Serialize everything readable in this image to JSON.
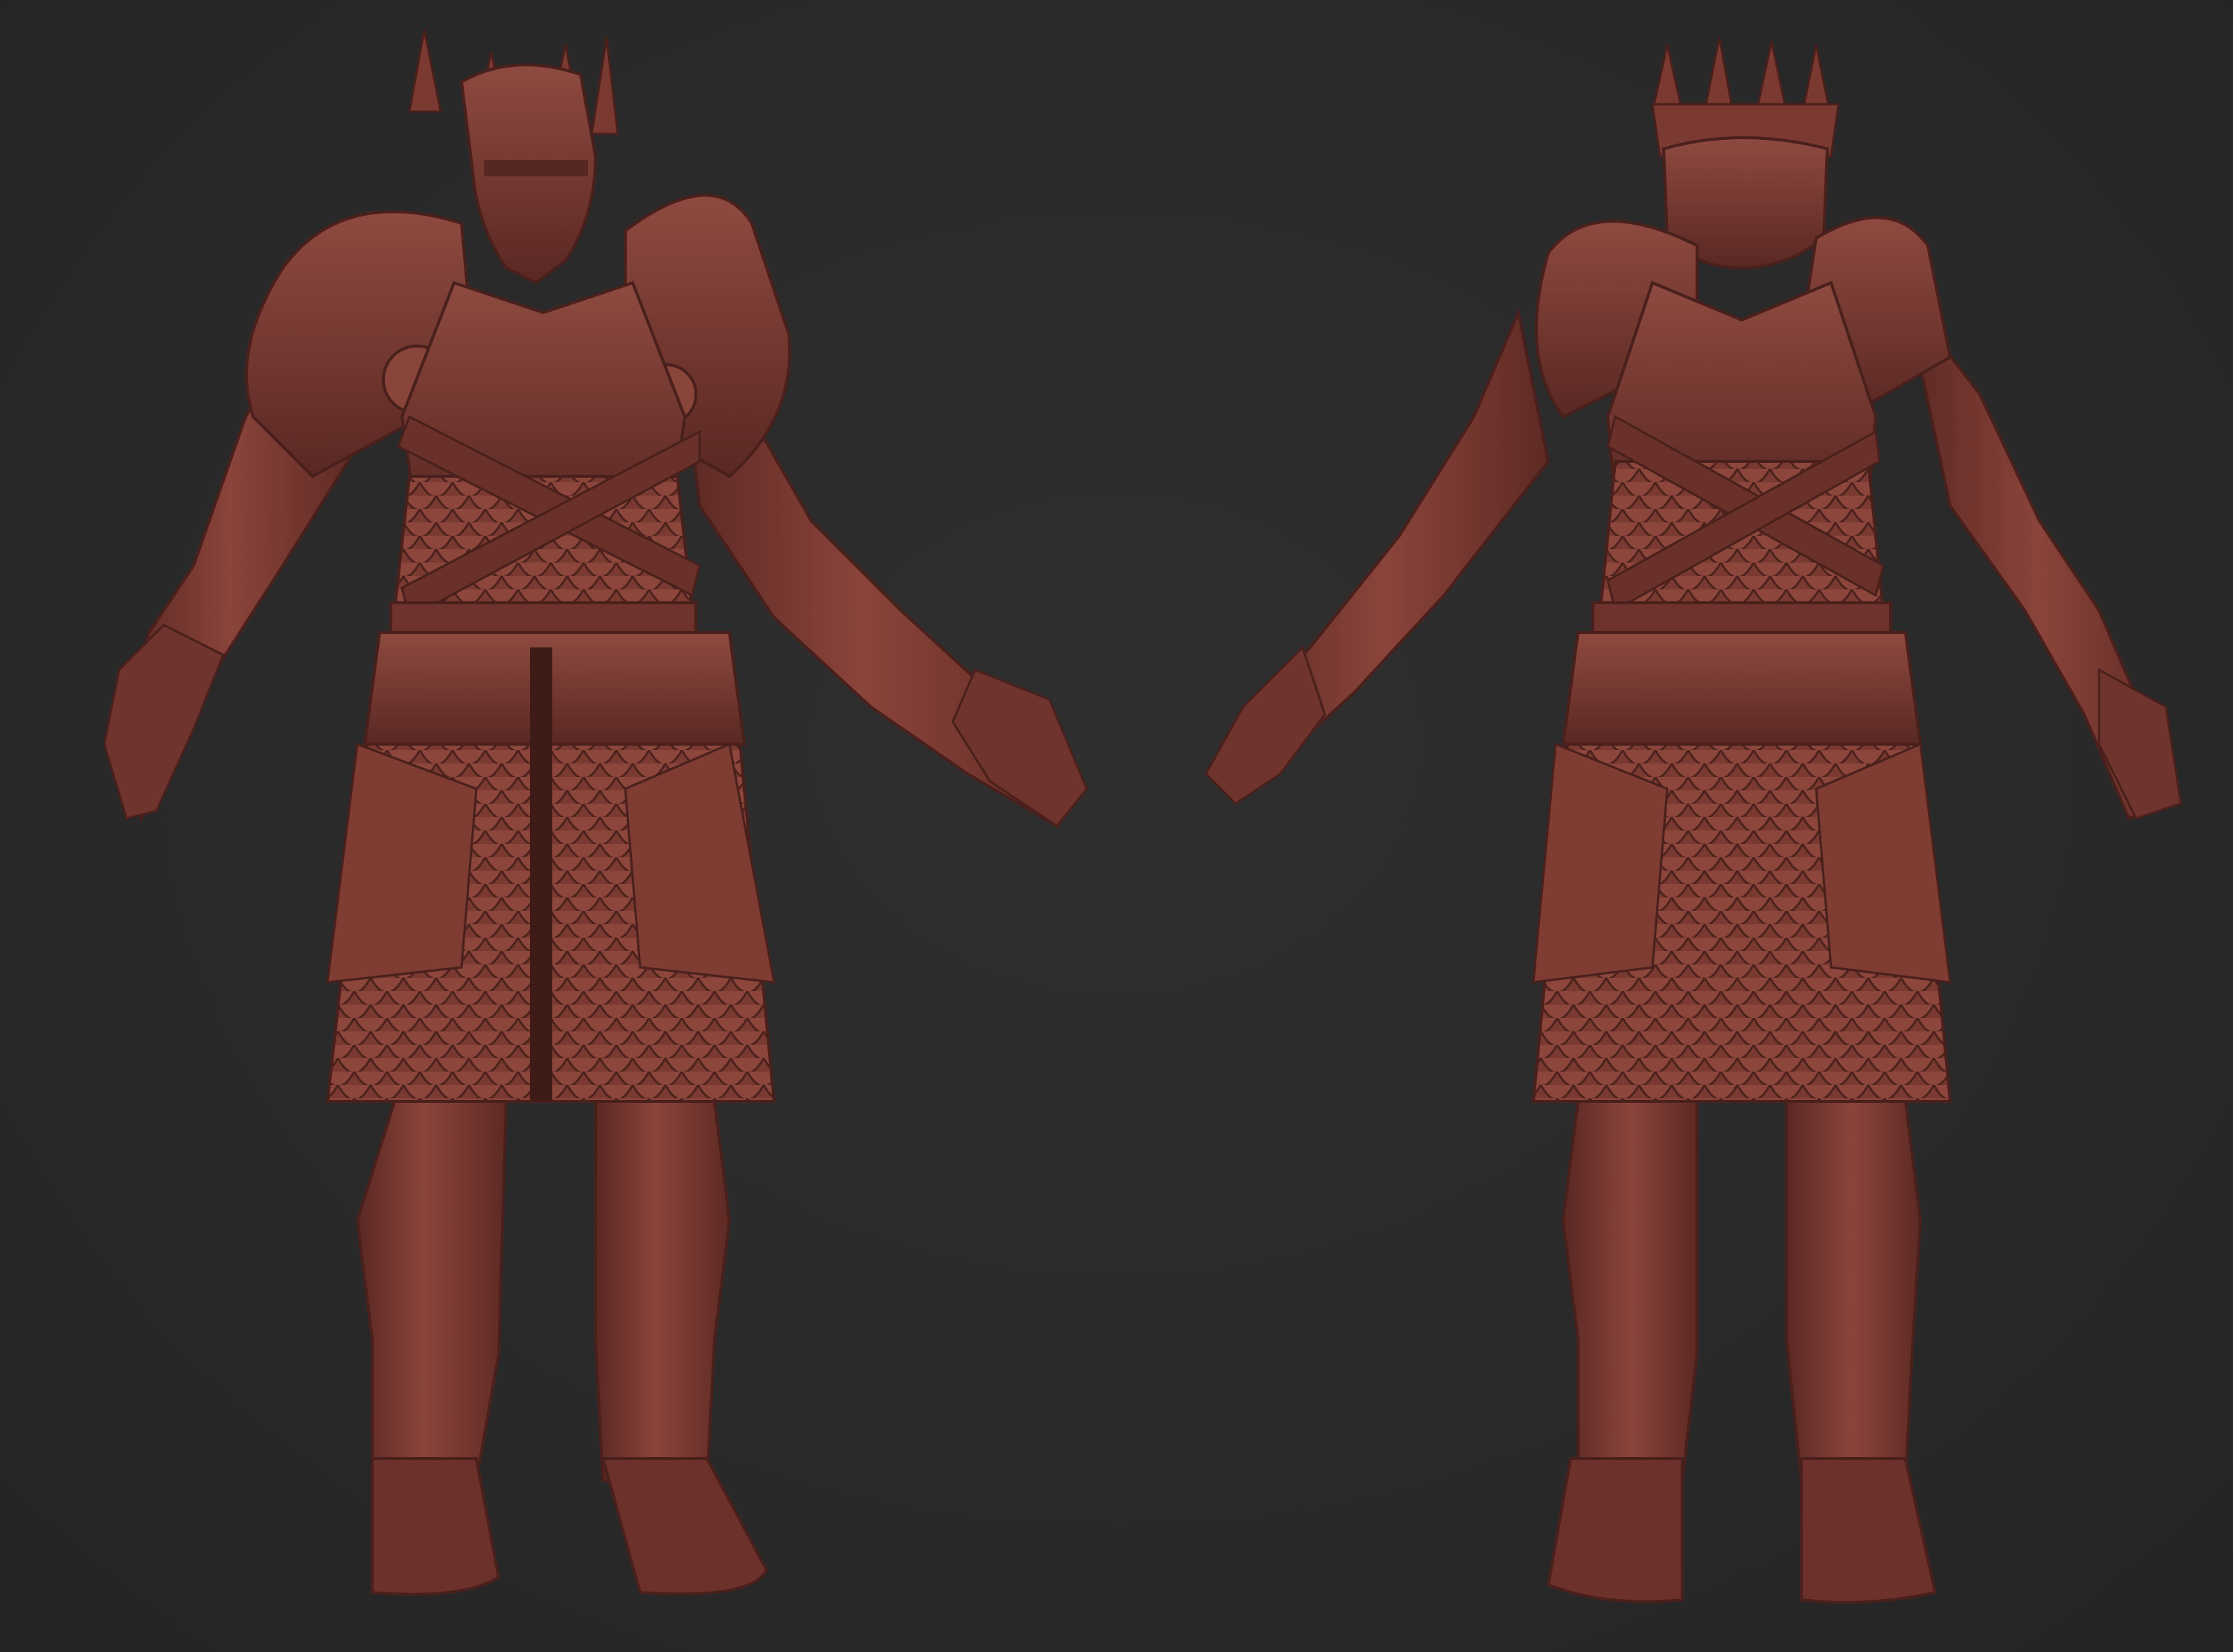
{
  "scene": {
    "background": "#2b2b2b",
    "material_color": "#7a3b34",
    "material_highlight": "#a5574c",
    "material_shadow": "#4a201c"
  },
  "views": [
    {
      "id": "front",
      "icon": "knight-front-view"
    },
    {
      "id": "back",
      "icon": "knight-back-view"
    }
  ]
}
